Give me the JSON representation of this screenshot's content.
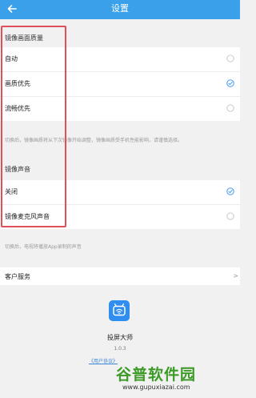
{
  "header": {
    "title": "设置",
    "back_icon": "back-arrow-icon"
  },
  "mirror_quality": {
    "title": "镜像画面质量",
    "options": [
      {
        "label": "自动",
        "selected": false
      },
      {
        "label": "画质优先",
        "selected": true
      },
      {
        "label": "流畅优先",
        "selected": false
      }
    ],
    "hint": "切换后，镜像画质将从下次镜像开始调整，镜像画质受手机性能影响，请谨慎选择。"
  },
  "mirror_audio": {
    "title": "镜像声音",
    "options": [
      {
        "label": "关闭",
        "selected": true
      },
      {
        "label": "镜像麦克风声音",
        "selected": false
      }
    ],
    "hint": "切换后，电视将播放App录制的声音"
  },
  "service": {
    "label": "客户服务",
    "chevron": ">"
  },
  "app": {
    "name": "投屏大师",
    "version": "1.0.3",
    "agreement": "《用户协议》"
  },
  "watermark": {
    "text": "谷普软件园",
    "url": "www.gupuxiazai.com"
  },
  "colors": {
    "accent": "#3aa0ea",
    "annotation": "#e0505a",
    "watermark": "#3c9a26"
  }
}
